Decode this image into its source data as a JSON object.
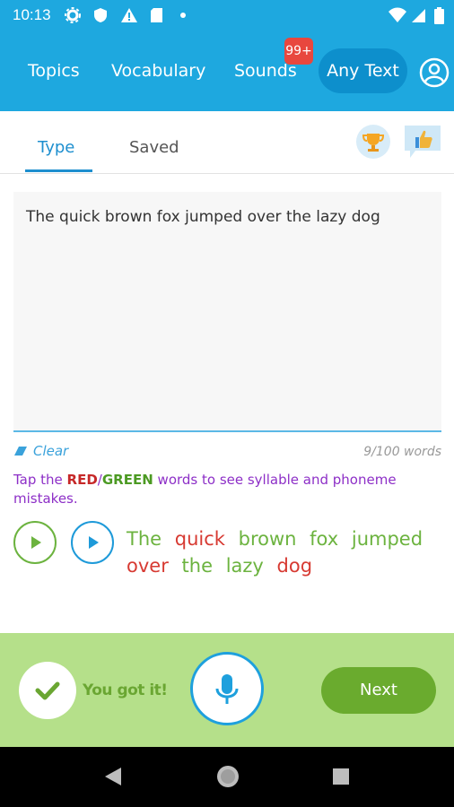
{
  "status_bar": {
    "time": "10:13"
  },
  "nav": {
    "items": [
      "Topics",
      "Vocabulary",
      "Sounds"
    ],
    "active": "Any Text",
    "badge": "99+"
  },
  "tabs": {
    "type": "Type",
    "saved": "Saved"
  },
  "editor": {
    "text": "The quick brown fox jumped over the lazy dog",
    "clear_label": "Clear",
    "counter": "9/100 words"
  },
  "instruction": {
    "prefix": "Tap the ",
    "red": "RED",
    "slash": "/",
    "green": "GREEN",
    "suffix": " words to see syllable and phoneme mistakes."
  },
  "result_words": [
    {
      "text": "The",
      "status": "correct"
    },
    {
      "text": "quick",
      "status": "incorrect"
    },
    {
      "text": "brown",
      "status": "correct"
    },
    {
      "text": "fox",
      "status": "correct"
    },
    {
      "text": "jumped",
      "status": "correct"
    },
    {
      "text": "over",
      "status": "incorrect"
    },
    {
      "text": "the",
      "status": "correct"
    },
    {
      "text": "lazy",
      "status": "correct"
    },
    {
      "text": "dog",
      "status": "incorrect"
    }
  ],
  "bottom": {
    "feedback": "You got it!",
    "next_label": "Next"
  },
  "colors": {
    "primary": "#1ea8df",
    "correct": "#6cb33f",
    "incorrect": "#d73a32",
    "panel": "#b5e08a",
    "next": "#6aab2e"
  }
}
